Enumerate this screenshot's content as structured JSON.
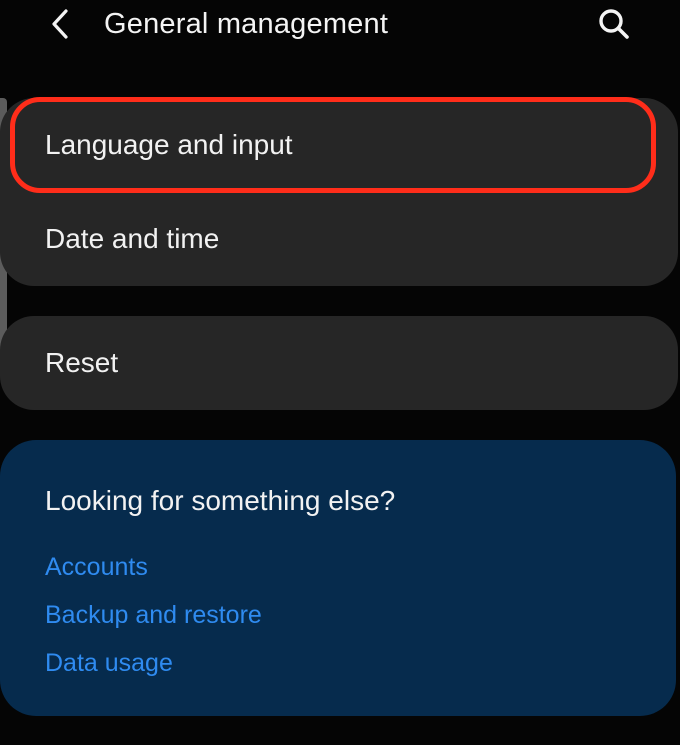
{
  "header": {
    "title": "General management",
    "back_icon": "chevron-left-icon",
    "search_icon": "search-icon"
  },
  "settings_group_1": {
    "items": [
      {
        "label": "Language and input"
      },
      {
        "label": "Date and time"
      }
    ]
  },
  "settings_group_2": {
    "items": [
      {
        "label": "Reset"
      }
    ]
  },
  "suggestions": {
    "title": "Looking for something else?",
    "links": [
      {
        "label": "Accounts"
      },
      {
        "label": "Backup and restore"
      },
      {
        "label": "Data usage"
      }
    ]
  },
  "colors": {
    "background": "#050505",
    "card": "#262626",
    "highlight": "#ff2d1a",
    "suggest_card": "#062b4d",
    "link": "#2f8bf0"
  }
}
